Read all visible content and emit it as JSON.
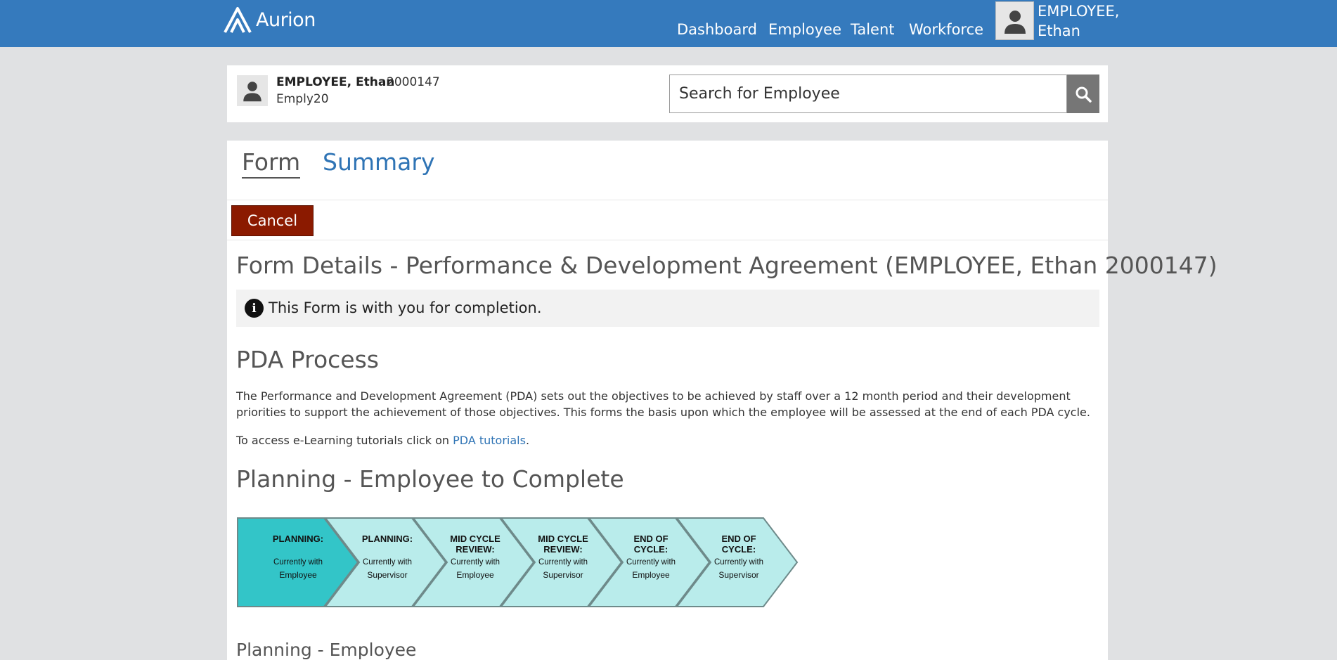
{
  "topbar": {
    "logo_text": "Aurion",
    "nav": [
      "Dashboard",
      "Employee",
      "Talent",
      "Workforce"
    ],
    "user_name_line1": "EMPLOYEE,",
    "user_name_line2": "Ethan"
  },
  "employee": {
    "name": "EMPLOYEE, Ethan",
    "id": "2000147",
    "code": "Emply20"
  },
  "search": {
    "placeholder": "Search for Employee"
  },
  "tabs": {
    "form": "Form",
    "summary": "Summary"
  },
  "actions": {
    "cancel": "Cancel"
  },
  "form": {
    "title": "Form Details - Performance & Development Agreement (EMPLOYEE, Ethan 2000147)",
    "info": "This Form is with you for completion.",
    "pda_title": "PDA Process",
    "pda_description": "The Performance and Development Agreement (PDA) sets out the objectives to be achieved by staff over a 12 month period and their development priorities to support the achievement of those objectives. This forms the basis upon which the employee will be assessed at the end of each PDA cycle.",
    "tutorial_prefix": "To access e-Learning tutorials click on ",
    "tutorial_link": "PDA tutorials",
    "tutorial_suffix": ".",
    "planning_title": "Planning - Employee to Complete",
    "sub_title": "Planning - Employee"
  },
  "process_steps": [
    {
      "title": [
        "PLANNING:"
      ],
      "sub": [
        "Currently with",
        "Employee"
      ],
      "active": true
    },
    {
      "title": [
        "PLANNING:"
      ],
      "sub": [
        "Currently with",
        "Supervisor"
      ],
      "active": false
    },
    {
      "title": [
        "MID CYCLE",
        "REVIEW:"
      ],
      "sub": [
        "Currently with",
        "Employee"
      ],
      "active": false
    },
    {
      "title": [
        "MID CYCLE",
        "REVIEW:"
      ],
      "sub": [
        "Currently with",
        "Supervisor"
      ],
      "active": false
    },
    {
      "title": [
        "END OF",
        "CYCLE:"
      ],
      "sub": [
        "Currently with",
        "Employee"
      ],
      "active": false
    },
    {
      "title": [
        "END OF",
        "CYCLE:"
      ],
      "sub": [
        "Currently with",
        "Supervisor"
      ],
      "active": false
    }
  ],
  "colors": {
    "topbar": "#357abd",
    "active_step": "#33c5c8",
    "inactive_step": "#b9eceb",
    "cancel": "#8b1a00",
    "link": "#2f74b5"
  }
}
